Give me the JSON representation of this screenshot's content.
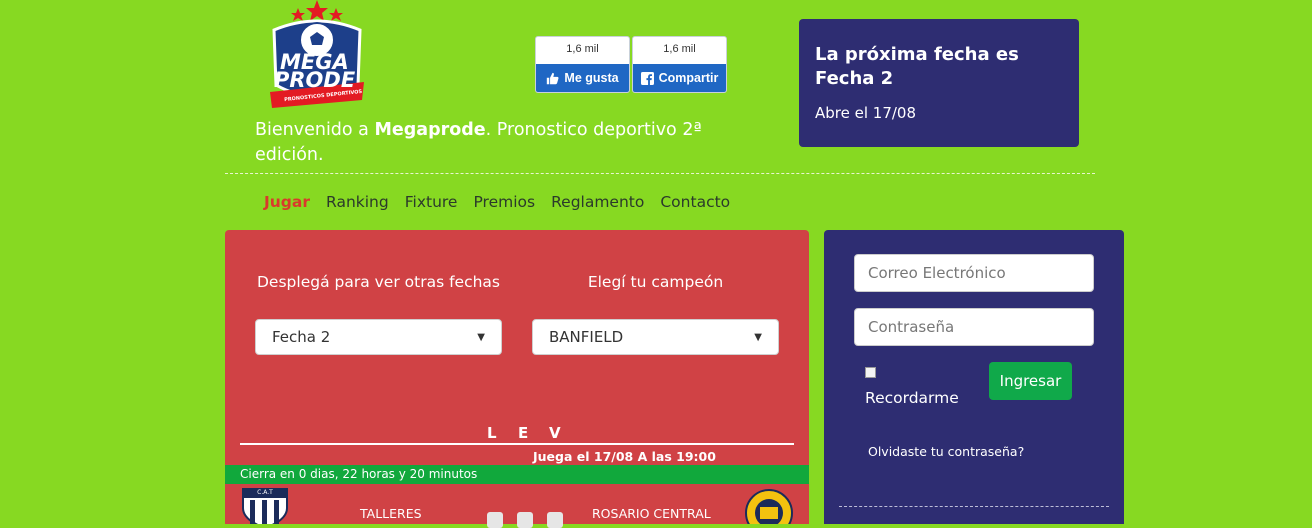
{
  "logo": {
    "line1": "MEGA",
    "line2": "PRODE",
    "ribbon": "PRONOSTICOS DEPORTIVOS"
  },
  "social": {
    "like": {
      "count": "1,6 mil",
      "label": "Me gusta"
    },
    "share": {
      "count": "1,6 mil",
      "label": "Compartir"
    }
  },
  "welcome": {
    "prefix": "Bienvenido a ",
    "brand": "Megaprode",
    "suffix": ". Pronostico deportivo 2ª edición."
  },
  "next_date": {
    "title": "La próxima fecha es Fecha 2",
    "subtitle": "Abre el 17/08"
  },
  "nav": [
    "Jugar",
    "Ranking",
    "Fixture",
    "Premios",
    "Reglamento",
    "Contacto"
  ],
  "game": {
    "dates_label": "Desplegá para ver otras fechas",
    "champion_label": "Elegí tu campeón",
    "date_selected": "Fecha 2",
    "champion_selected": "BANFIELD",
    "lev": [
      "L",
      "E",
      "V"
    ],
    "match_time": "Juega el 17/08 A las 19:00",
    "closes": "Cierra en 0 dias, 22 horas y 20 minutos",
    "home": "TALLERES",
    "home_crest": "C.A.T",
    "away": "ROSARIO CENTRAL"
  },
  "login": {
    "email_placeholder": "Correo Electrónico",
    "password_placeholder": "Contraseña",
    "remember": "Recordarme",
    "submit": "Ingresar",
    "forgot": "Olvidaste tu contraseña?"
  },
  "colors": {
    "background": "#87d922",
    "panel_red": "#d04245",
    "panel_navy": "#2e2d72",
    "green": "#11a83c",
    "facebook": "#1f67c4",
    "active_nav": "#d93a2b"
  }
}
